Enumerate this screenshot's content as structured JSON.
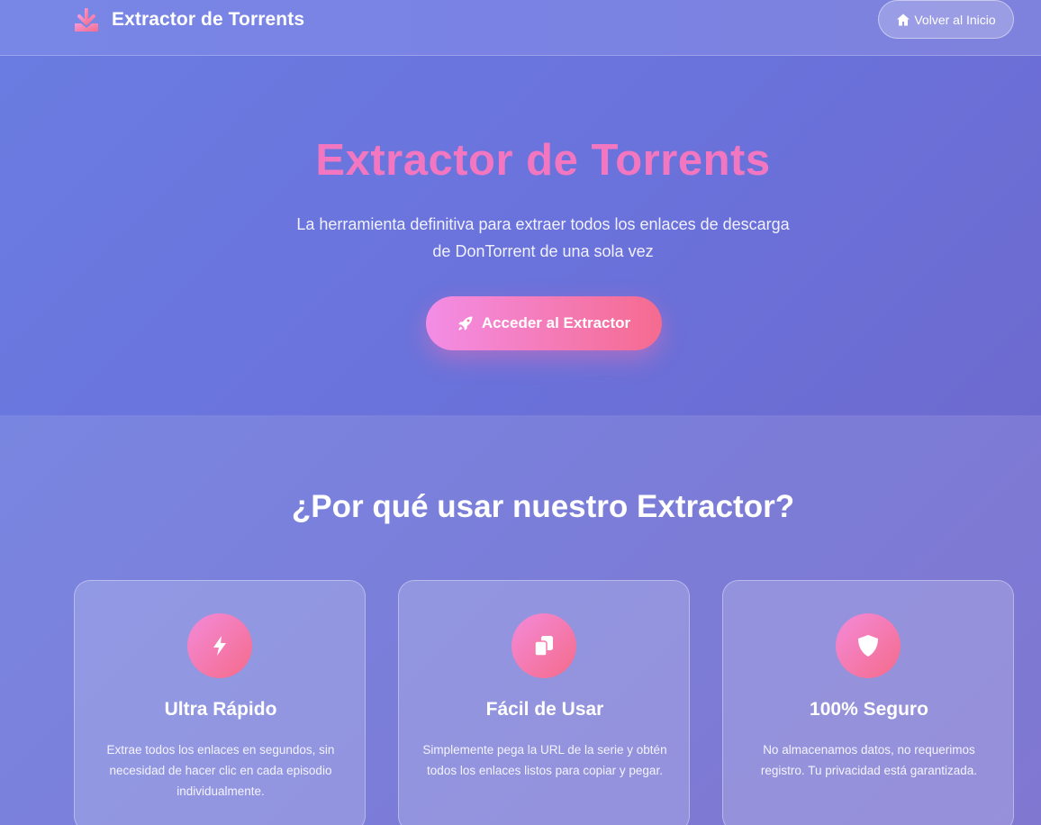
{
  "navbar": {
    "brand_text": "Extractor de Torrents",
    "brand_icon": "download-icon",
    "home_button": "Volver al Inicio",
    "home_icon": "home-icon"
  },
  "hero": {
    "title": "Extractor de Torrents",
    "subtitle": "La herramienta definitiva para extraer todos los enlaces de descarga de DonTorrent de una sola vez",
    "cta_label": "Acceder al Extractor",
    "cta_icon": "rocket-icon"
  },
  "features": {
    "title": "¿Por qué usar nuestro Extractor?",
    "cards": [
      {
        "icon": "lightning-icon",
        "title": "Ultra Rápido",
        "text": "Extrae todos los enlaces en segundos, sin necesidad de hacer clic en cada episodio individualmente."
      },
      {
        "icon": "copy-icon",
        "title": "Fácil de Usar",
        "text": "Simplemente pega la URL de la serie y obtén todos los enlaces listos para copiar y pegar."
      },
      {
        "icon": "shield-icon",
        "title": "100% Seguro",
        "text": "No almacenamos datos, no requerimos registro. Tu privacidad está garantizada."
      }
    ]
  },
  "colors": {
    "accent_pink": "#f377c0",
    "button_gradient_start": "#f38de6",
    "button_gradient_end": "#f56b8f"
  }
}
